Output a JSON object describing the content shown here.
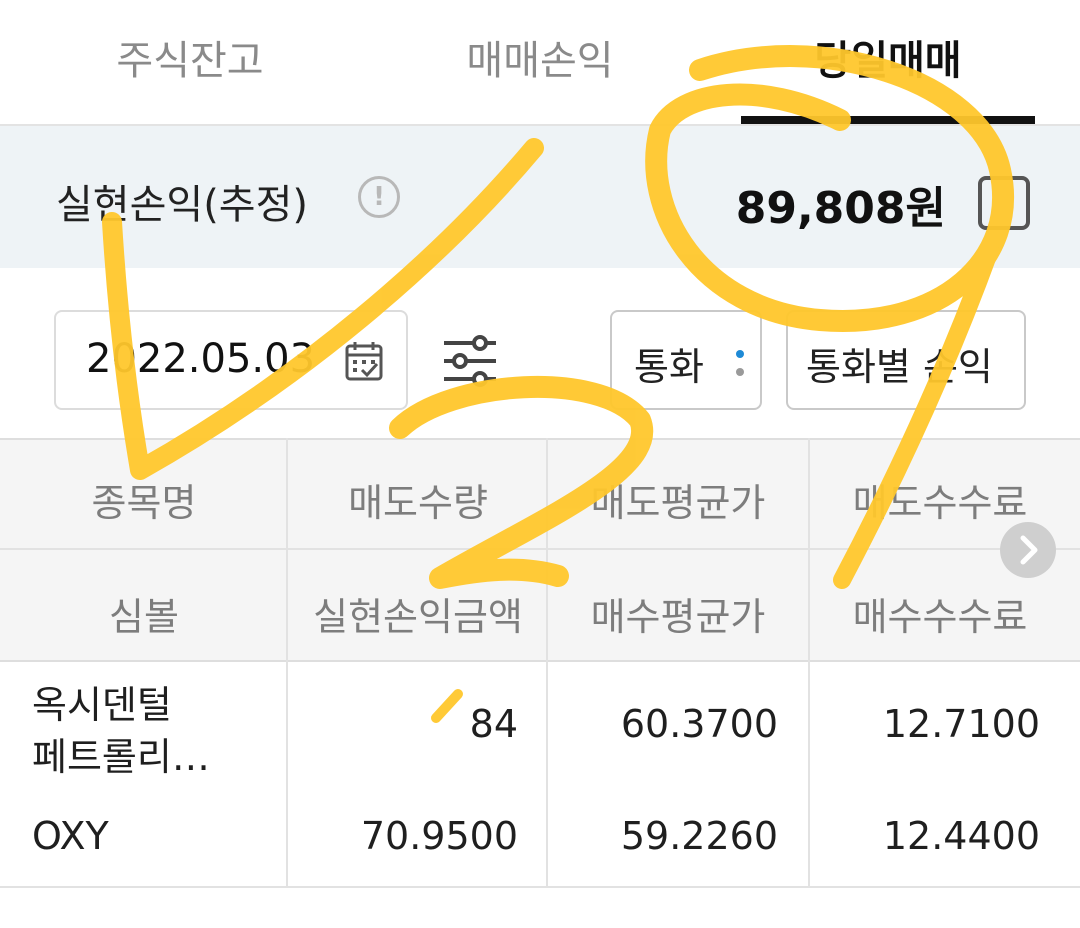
{
  "tabs": [
    {
      "label": "주식잔고"
    },
    {
      "label": "매매손익"
    },
    {
      "label": "당일매매"
    }
  ],
  "summary": {
    "label": "실현손익(추정)",
    "info_glyph": "!",
    "value": "89,808원"
  },
  "controls": {
    "date": "2022.05.03",
    "currency_select": "통화",
    "pnl_by_currency_button": "통화별 손익"
  },
  "table": {
    "header_row1": [
      "종목명",
      "매도수량",
      "매도평균가",
      "매도수수료"
    ],
    "header_row2": [
      "심볼",
      "실현손익금액",
      "매수평균가",
      "매수수수료"
    ],
    "rows": [
      {
        "name_line1": "옥시덴털",
        "name_line2": "페트롤리…",
        "sell_qty": "84",
        "sell_avg": "60.3700",
        "sell_fee": "12.7100"
      },
      {
        "symbol": "OXY",
        "realized_pnl": "70.9500",
        "buy_avg": "59.2260",
        "buy_fee": "12.4400"
      }
    ]
  },
  "colors": {
    "scribble": "#ffc72c",
    "summary_bg": "#eef3f6",
    "header_bg": "#f5f5f5",
    "accent_dot": "#1e8ad6"
  }
}
